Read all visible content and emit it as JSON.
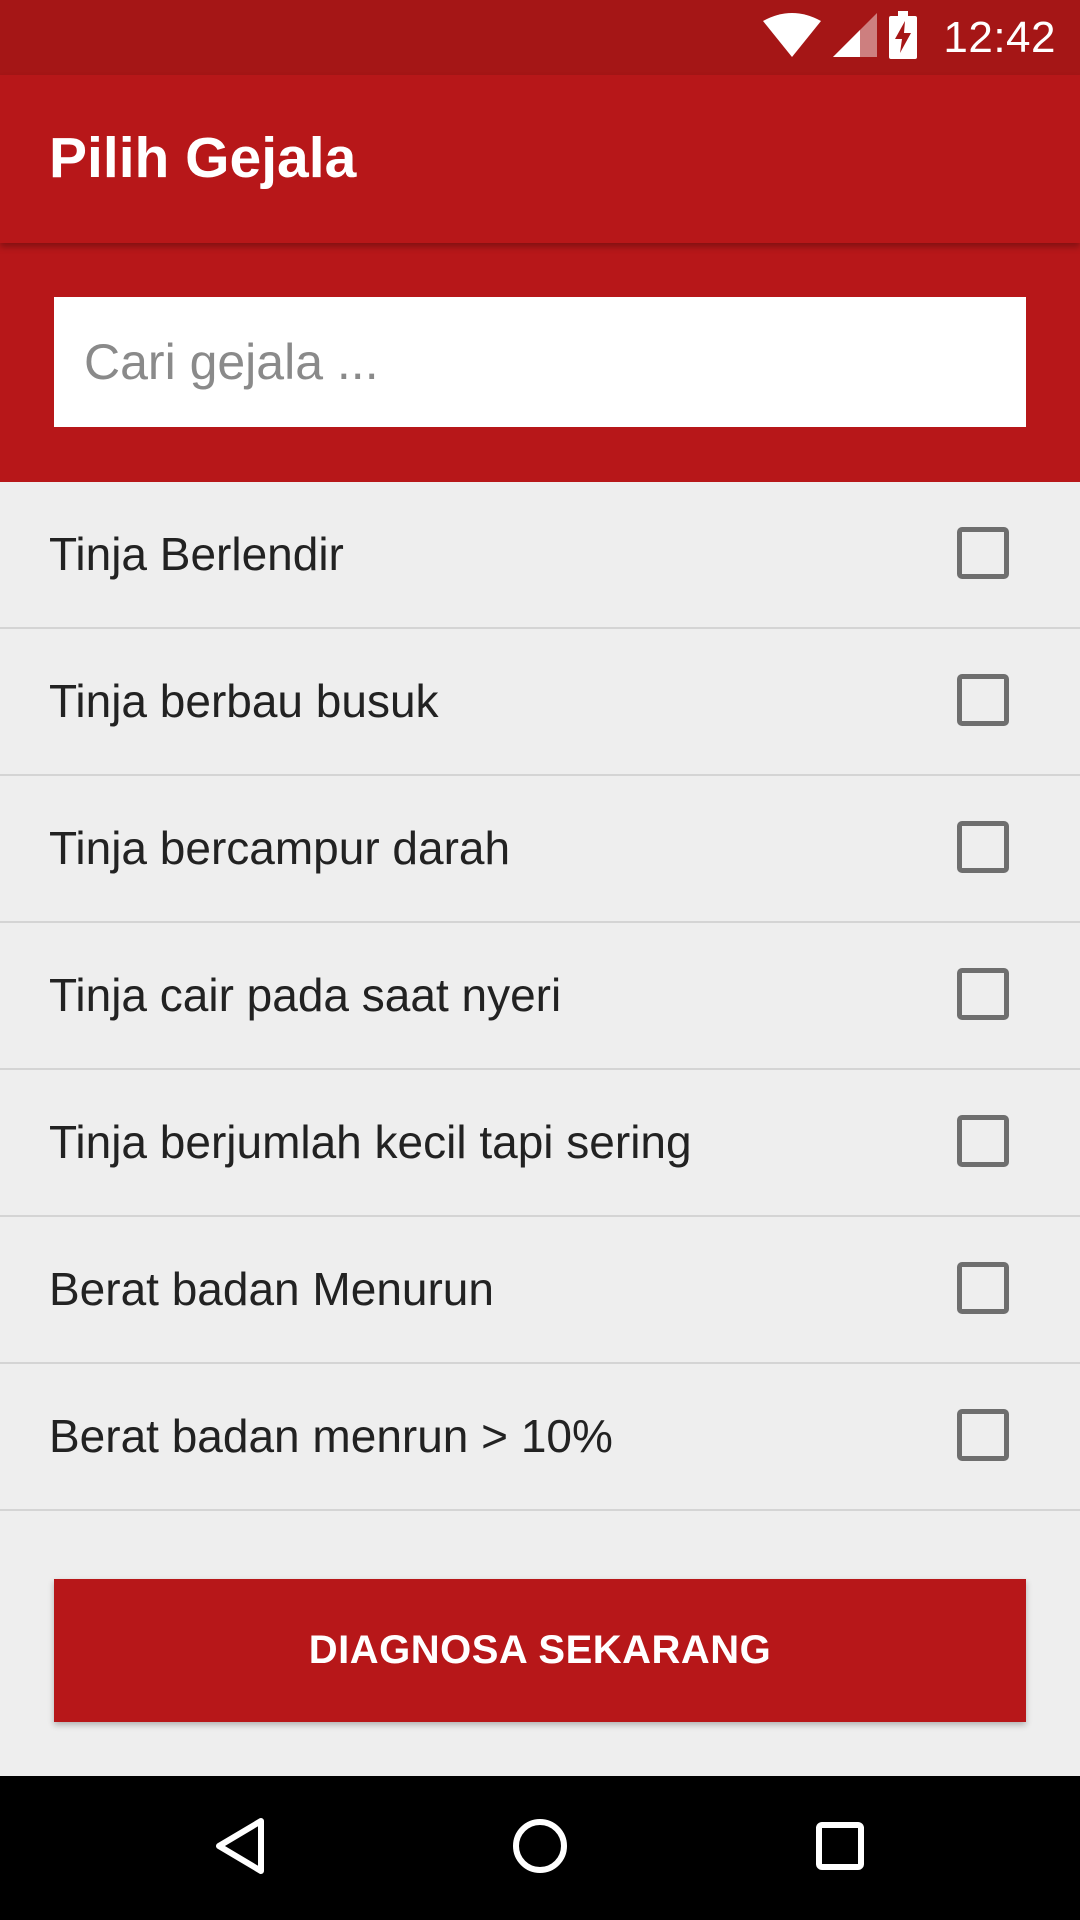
{
  "status_bar": {
    "time": "12:42",
    "icons": [
      "wifi-icon",
      "signal-icon",
      "battery-charging-icon"
    ]
  },
  "app_bar": {
    "title": "Pilih Gejala"
  },
  "search": {
    "placeholder": "Cari gejala ...",
    "value": ""
  },
  "symptoms": [
    {
      "label": "Tinja Berlendir",
      "checked": false
    },
    {
      "label": "Tinja berbau busuk",
      "checked": false
    },
    {
      "label": "Tinja bercampur darah",
      "checked": false
    },
    {
      "label": "Tinja cair pada saat nyeri",
      "checked": false
    },
    {
      "label": "Tinja berjumlah kecil tapi sering",
      "checked": false
    },
    {
      "label": "Berat badan Menurun",
      "checked": false
    },
    {
      "label": "Berat badan menrun > 10%",
      "checked": false
    }
  ],
  "diagnose_button": {
    "label": "DIAGNOSA SEKARANG"
  },
  "nav_bar": {
    "icons": [
      "back-icon",
      "home-icon",
      "recents-icon"
    ]
  },
  "colors": {
    "primary": "#b71719",
    "primary_dark": "#a51616",
    "background": "#eeeeee",
    "divider": "#d4d4d4"
  }
}
